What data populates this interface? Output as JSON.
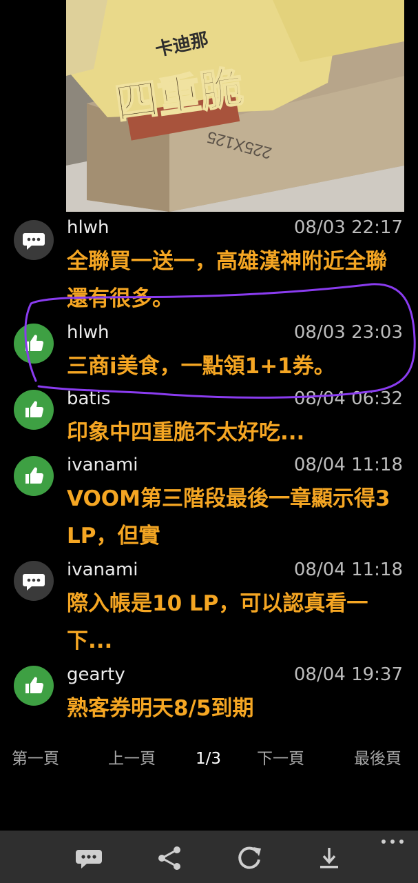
{
  "photo": {
    "package_text": "四重脆",
    "brand_text": "卡迪那",
    "box_text": "225X125"
  },
  "comments": [
    {
      "user": "hlwh",
      "time": "08/03 22:17",
      "text": "全聯買一送一，高雄漢神附近全聯還有很多。",
      "icon": "speech-bubble-icon"
    },
    {
      "user": "hlwh",
      "time": "08/03 23:03",
      "text": "三商i美食，一點領1+1券。",
      "icon": "thumbs-up-icon"
    },
    {
      "user": "batis",
      "time": "08/04 06:32",
      "text": "印象中四重脆不太好吃...",
      "icon": "thumbs-up-icon"
    },
    {
      "user": "ivanami",
      "time": "08/04 11:18",
      "text": "VOOM第三階段最後一章顯示得3 LP，但實",
      "icon": "thumbs-up-icon"
    },
    {
      "user": "ivanami",
      "time": "08/04 11:18",
      "text": "際入帳是10 LP，可以認真看一下...",
      "icon": "speech-bubble-icon"
    },
    {
      "user": "gearty",
      "time": "08/04 19:37",
      "text": "熟客券明天8/5到期",
      "icon": "thumbs-up-icon"
    }
  ],
  "pager": {
    "first": "第一頁",
    "prev": "上一頁",
    "current": "1/3",
    "next": "下一頁",
    "last": "最後頁"
  },
  "bottom_bar": {
    "icons": [
      "comment-icon",
      "share-icon",
      "refresh-icon",
      "download-icon",
      "more-icon"
    ]
  },
  "colors": {
    "background": "#000000",
    "comment_text": "#f5a623",
    "like_avatar": "#3ea043",
    "speech_avatar": "#3a3a3a",
    "annotation_stroke": "#8a3cf0",
    "bottom_bar": "#2f2f2f"
  }
}
